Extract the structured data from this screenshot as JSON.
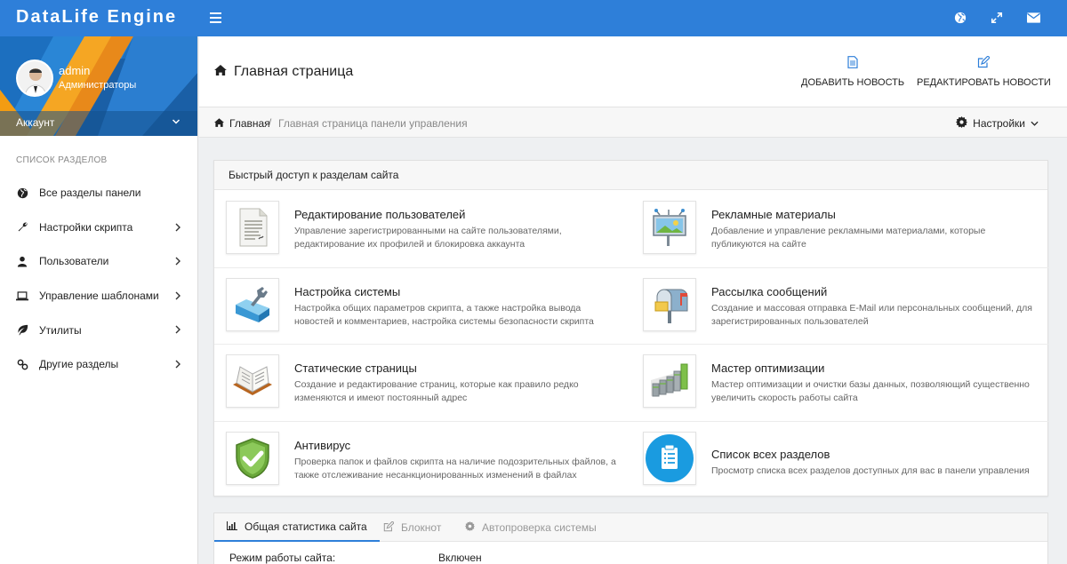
{
  "app": {
    "brand": "DataLife Engine"
  },
  "topbar": {
    "icons": [
      "globe-icon",
      "expand-icon",
      "envelope-icon"
    ]
  },
  "user": {
    "name": "admin",
    "group": "Администраторы",
    "account_label": "Аккаунт"
  },
  "sidebar": {
    "title": "СПИСОК РАЗДЕЛОВ",
    "items": [
      {
        "label": "Все разделы панели",
        "icon": "globe-icon",
        "arrow": false
      },
      {
        "label": "Настройки скрипта",
        "icon": "wrench-icon",
        "arrow": true
      },
      {
        "label": "Пользователи",
        "icon": "user-icon",
        "arrow": true
      },
      {
        "label": "Управление шаблонами",
        "icon": "laptop-icon",
        "arrow": true
      },
      {
        "label": "Утилиты",
        "icon": "leaf-icon",
        "arrow": true
      },
      {
        "label": "Другие разделы",
        "icon": "link-icon",
        "arrow": true
      }
    ]
  },
  "header": {
    "title": "Главная страница",
    "add_news": "ДОБАВИТЬ НОВОСТЬ",
    "edit_news": "РЕДАКТИРОВАТЬ НОВОСТИ"
  },
  "breadcrumb": {
    "home": "Главная",
    "separator": "/",
    "current": "Главная страница панели управления",
    "settings": "Настройки"
  },
  "quick": {
    "title": "Быстрый доступ к разделам сайта",
    "items": [
      {
        "title": "Редактирование пользователей",
        "desc": "Управление зарегистрированными на сайте пользователями, редактирование их профилей и блокировка аккаунта",
        "icon": "document-icon"
      },
      {
        "title": "Рекламные материалы",
        "desc": "Добавление и управление рекламными материалами, которые публикуются на сайте",
        "icon": "billboard-icon"
      },
      {
        "title": "Настройка системы",
        "desc": "Настройка общих параметров скрипта, а также настройка вывода новостей и комментариев, настройка системы безопасности скрипта",
        "icon": "toolbox-icon"
      },
      {
        "title": "Рассылка сообщений",
        "desc": "Создание и массовая отправка E-Mail или персональных сообщений, для зарегистрированных пользователей",
        "icon": "mailbox-icon"
      },
      {
        "title": "Статические страницы",
        "desc": "Создание и редактирование страниц, которые как правило редко изменяются и имеют постоянный адрес",
        "icon": "book-icon"
      },
      {
        "title": "Мастер оптимизации",
        "desc": "Мастер оптимизации и очистки базы данных, позволяющий существенно увеличить скорость работы сайта",
        "icon": "bar-chart-icon"
      },
      {
        "title": "Антивирус",
        "desc": "Проверка папок и файлов скрипта на наличие подозрительных файлов, а также отслеживание несанкционированных изменений в файлах",
        "icon": "shield-check-icon"
      },
      {
        "title": "Список всех разделов",
        "desc": "Просмотр списка всех разделов доступных для вас в панели управления",
        "icon": "clipboard-list-icon"
      }
    ]
  },
  "stats": {
    "tabs": [
      "Общая статистика сайта",
      "Блокнот",
      "Автопроверка системы"
    ],
    "row_label": "Режим работы сайта:",
    "row_value": "Включен"
  },
  "colors": {
    "accent": "#2e7fd9",
    "sidebar_blue": "#1c6fbf",
    "orange": "#f39c12"
  }
}
